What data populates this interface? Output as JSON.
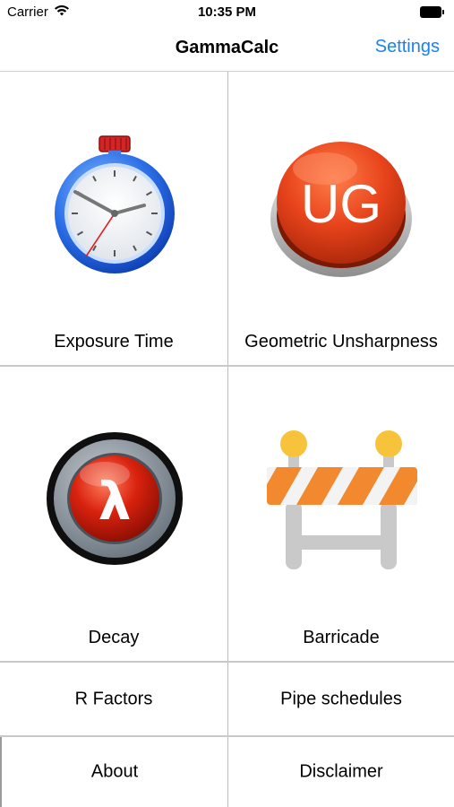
{
  "status_bar": {
    "carrier": "Carrier",
    "time": "10:35 PM"
  },
  "nav": {
    "title": "GammaCalc",
    "settings": "Settings"
  },
  "tiles": {
    "exposure_time": {
      "label": "Exposure Time",
      "icon": "stopwatch-icon"
    },
    "geometric_unsharpness": {
      "label": "Geometric Unsharpness",
      "icon": "ug-button-icon",
      "icon_text": "UG"
    },
    "decay": {
      "label": "Decay",
      "icon": "lambda-button-icon",
      "icon_text": "λ"
    },
    "barricade": {
      "label": "Barricade",
      "icon": "barricade-icon"
    }
  },
  "rows": {
    "r_factors": "R Factors",
    "pipe_schedules": "Pipe schedules",
    "about": "About",
    "disclaimer": "Disclaimer"
  },
  "colors": {
    "accent": "#1a82f0",
    "ug_red": "#e8441b",
    "lambda_red": "#d9220e",
    "barricade_orange": "#f2892f"
  }
}
